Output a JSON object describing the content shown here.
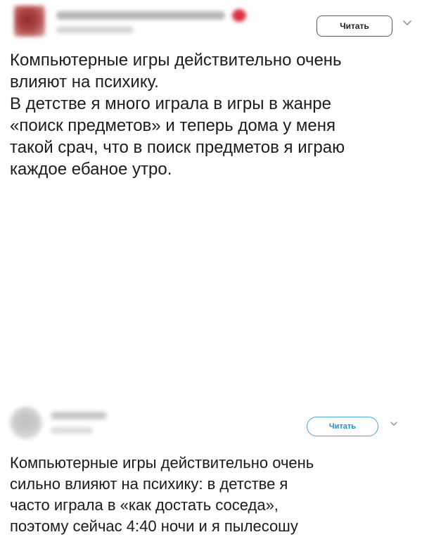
{
  "tweets": [
    {
      "follow_label": "Читать",
      "chevron_icon": "chevron-down-icon",
      "text": "Компьютерные игры действительно очень\nвлияют на психику.\nВ детстве я много играла в игры в жанре\n«поиск предметов» и теперь дома у меня\nтакой срач, что в поиск предметов я играю\nкаждое ебаное утро."
    },
    {
      "follow_label": "Читать",
      "chevron_icon": "chevron-down-icon",
      "text": "Компьютерные игры действительно очень\nсильно влияют на психику: в детстве я\nчасто играла в «как достать соседа»,\nпоэтому сейчас 4:40 ночи и я пылесошу"
    }
  ],
  "colors": {
    "follow_border_dark": "#5c5c5c",
    "follow_accent_blue": "#1f8dd6",
    "chevron_gray": "#8899a6"
  }
}
